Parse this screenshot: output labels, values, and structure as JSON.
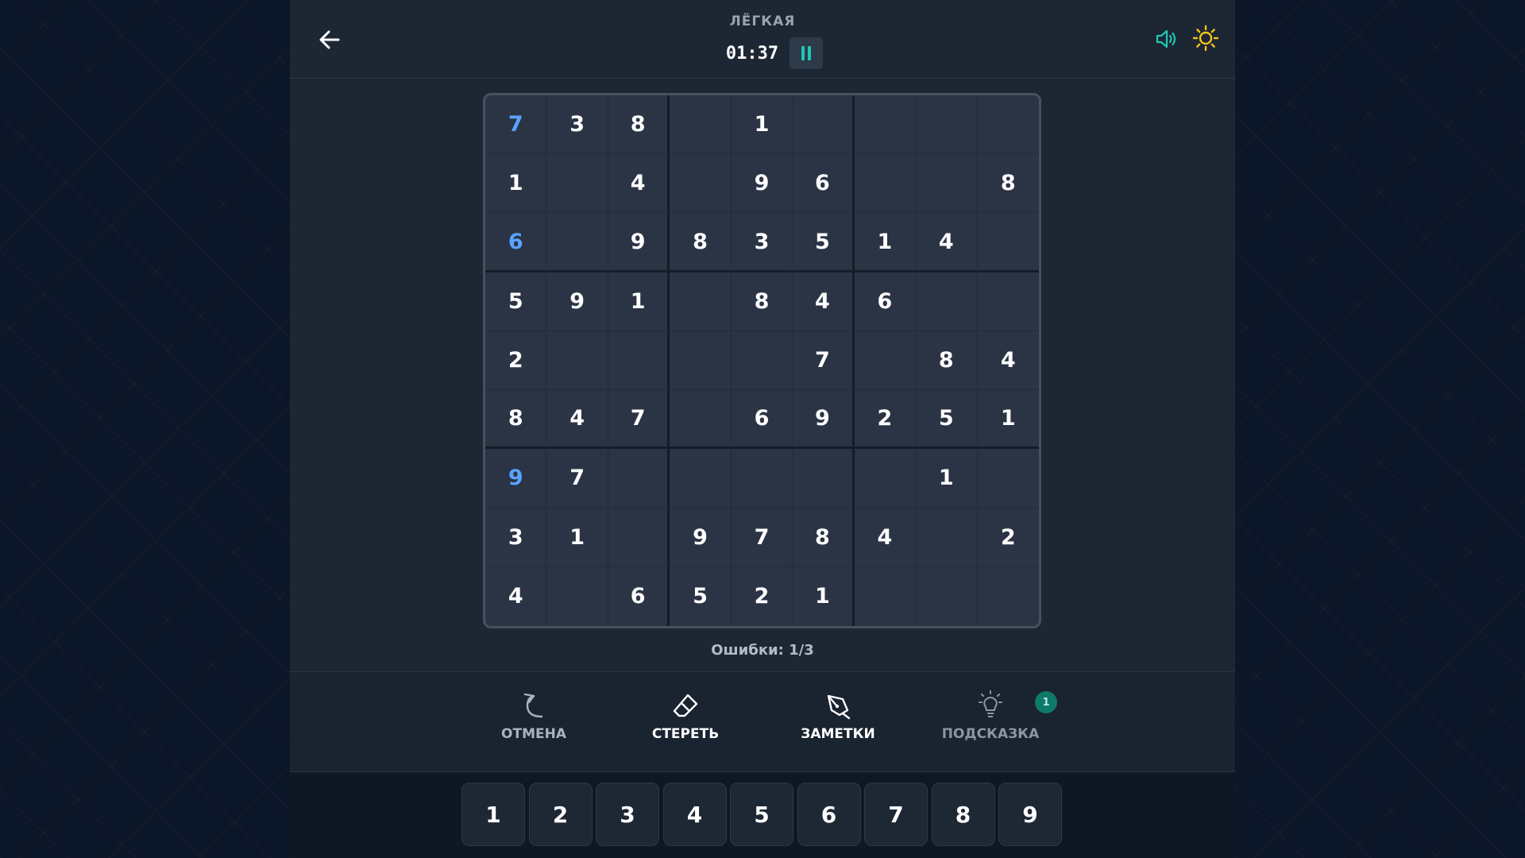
{
  "header": {
    "difficulty": "ЛЁГКАЯ",
    "timer": "01:37"
  },
  "board": {
    "cells": [
      [
        "7",
        "3",
        "8",
        "",
        "1",
        "",
        "",
        "",
        ""
      ],
      [
        "1",
        "",
        "4",
        "",
        "9",
        "6",
        "",
        "",
        "8"
      ],
      [
        "6",
        "",
        "9",
        "8",
        "3",
        "5",
        "1",
        "4",
        ""
      ],
      [
        "5",
        "9",
        "1",
        "",
        "8",
        "4",
        "6",
        "",
        ""
      ],
      [
        "2",
        "",
        "",
        "",
        "",
        "7",
        "",
        "8",
        "4"
      ],
      [
        "8",
        "4",
        "7",
        "",
        "6",
        "9",
        "2",
        "5",
        "1"
      ],
      [
        "9",
        "7",
        "",
        "",
        "",
        "",
        "",
        "1",
        ""
      ],
      [
        "3",
        "1",
        "",
        "9",
        "7",
        "8",
        "4",
        "",
        "2"
      ],
      [
        "4",
        "",
        "6",
        "5",
        "2",
        "1",
        "",
        "",
        ""
      ]
    ],
    "blue_cells": [
      [
        0,
        0
      ],
      [
        2,
        0
      ],
      [
        6,
        0
      ]
    ]
  },
  "status": {
    "mistakes": "Ошибки: 1/3"
  },
  "toolbar": {
    "undo_label": "ОТМЕНА",
    "erase_label": "СТЕРЕТЬ",
    "notes_label": "ЗАМЕТКИ",
    "hint_label": "ПОДСКАЗКА",
    "hint_count": "1"
  },
  "numpad": {
    "keys": [
      "1",
      "2",
      "3",
      "4",
      "5",
      "6",
      "7",
      "8",
      "9"
    ]
  },
  "colors": {
    "accent": "#1ec8b4",
    "blue_digit": "#5aa2ff",
    "sun": "#f5c518"
  },
  "icons": {
    "back": "arrow-left-icon",
    "pause": "pause-icon",
    "sound": "speaker-icon",
    "theme": "sun-icon",
    "undo": "undo-arrow-icon",
    "erase": "eraser-icon",
    "notes": "pen-icon",
    "hint": "lightbulb-icon"
  }
}
